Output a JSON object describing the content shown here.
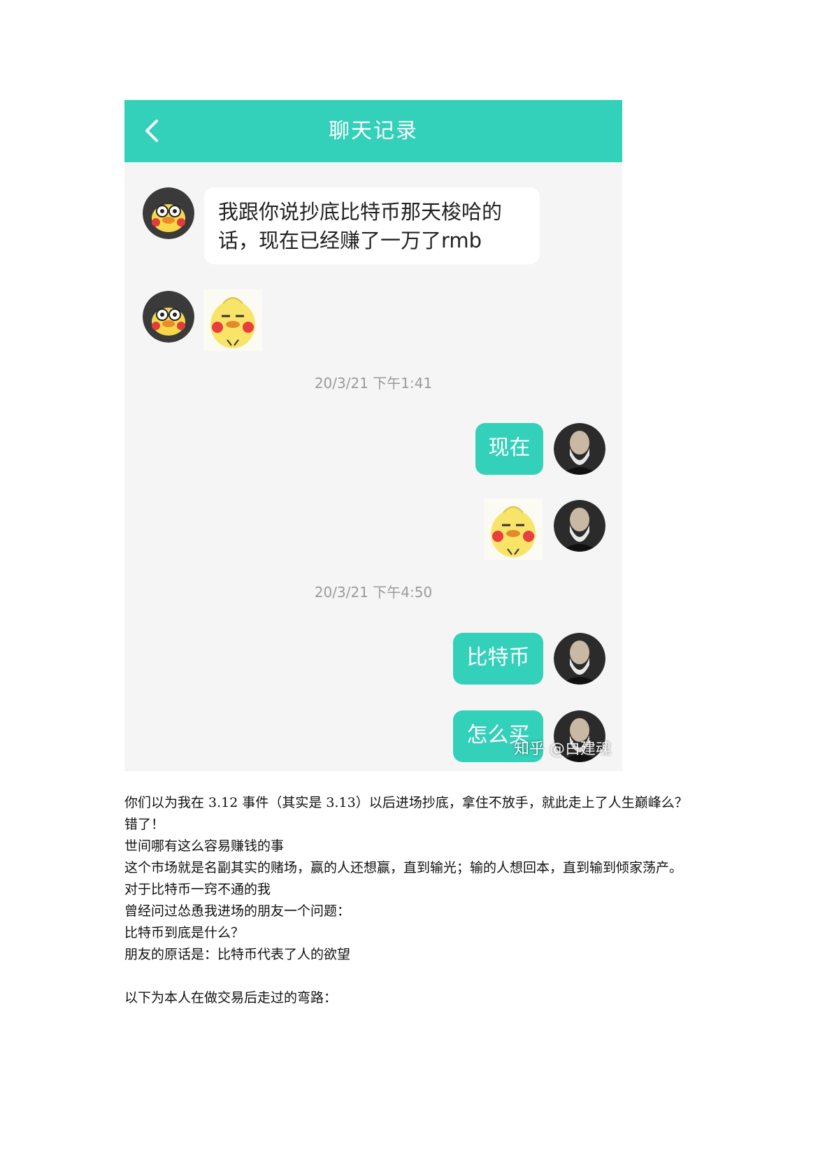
{
  "chat": {
    "title": "聊天记录",
    "messages": [
      {
        "side": "left",
        "type": "text",
        "text": "我跟你说抄底比特币那天梭哈的话，现在已经赚了一万了rmb"
      },
      {
        "side": "left",
        "type": "sticker",
        "sticker": "yellow-duck-sticker"
      }
    ],
    "timestamp1": "20/3/21 下午1:41",
    "msg_now": "现在",
    "timestamp2": "20/3/21 下午4:50",
    "msg_bitcoin": "比特币",
    "msg_howbuy": "怎么买",
    "watermark": "知乎 @白建魂",
    "accent_color": "#33d0ba"
  },
  "article": {
    "paragraphs": [
      "你们以为我在 3.12 事件（其实是 3.13）以后进场抄底，拿住不放手，就此走上了人生巅峰么？",
      "错了！",
      "世间哪有这么容易赚钱的事",
      "这个市场就是名副其实的赌场，赢的人还想赢，直到输光；输的人想回本，直到输到倾家荡产。",
      "对于比特币一窍不通的我",
      "曾经问过怂恿我进场的朋友一个问题：",
      "比特币到底是什么？",
      "朋友的原话是：比特币代表了人的欲望"
    ],
    "closing": "以下为本人在做交易后走过的弯路："
  }
}
